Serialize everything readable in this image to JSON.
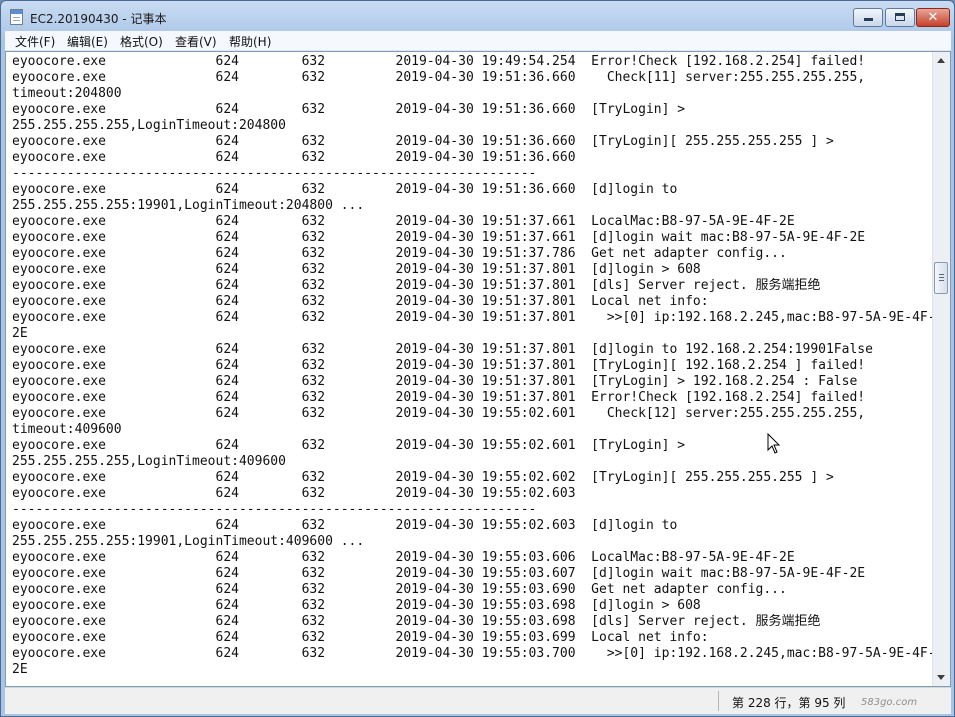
{
  "window": {
    "title": "EC2.20190430 - 记事本",
    "minimize_glyph": "",
    "close_glyph": "✕"
  },
  "menu": [
    {
      "label": "文件(F)"
    },
    {
      "label": "编辑(E)"
    },
    {
      "label": "格式(O)"
    },
    {
      "label": "查看(V)"
    },
    {
      "label": "帮助(H)"
    }
  ],
  "document": {
    "lines": [
      "eyoocore.exe              624        632         2019-04-30 19:49:54.254  Error!Check [192.168.2.254] failed!",
      "eyoocore.exe              624        632         2019-04-30 19:51:36.660    Check[11] server:255.255.255.255,",
      "timeout:204800",
      "eyoocore.exe              624        632         2019-04-30 19:51:36.660  [TryLogin] >",
      "255.255.255.255,LoginTimeout:204800",
      "eyoocore.exe              624        632         2019-04-30 19:51:36.660  [TryLogin][ 255.255.255.255 ] >",
      "eyoocore.exe              624        632         2019-04-30 19:51:36.660",
      "-------------------------------------------------------------------",
      "eyoocore.exe              624        632         2019-04-30 19:51:36.660  [d]login to",
      "255.255.255.255:19901,LoginTimeout:204800 ...",
      "eyoocore.exe              624        632         2019-04-30 19:51:37.661  LocalMac:B8-97-5A-9E-4F-2E",
      "eyoocore.exe              624        632         2019-04-30 19:51:37.661  [d]login wait mac:B8-97-5A-9E-4F-2E",
      "eyoocore.exe              624        632         2019-04-30 19:51:37.786  Get net adapter config...",
      "eyoocore.exe              624        632         2019-04-30 19:51:37.801  [d]login > 608",
      "eyoocore.exe              624        632         2019-04-30 19:51:37.801  [dls] Server reject. 服务端拒绝",
      "eyoocore.exe              624        632         2019-04-30 19:51:37.801  Local net info:",
      "eyoocore.exe              624        632         2019-04-30 19:51:37.801    >>[0] ip:192.168.2.245,mac:B8-97-5A-9E-4F-",
      "2E",
      "eyoocore.exe              624        632         2019-04-30 19:51:37.801  [d]login to 192.168.2.254:19901False",
      "eyoocore.exe              624        632         2019-04-30 19:51:37.801  [TryLogin][ 192.168.2.254 ] failed!",
      "eyoocore.exe              624        632         2019-04-30 19:51:37.801  [TryLogin] > 192.168.2.254 : False",
      "eyoocore.exe              624        632         2019-04-30 19:51:37.801  Error!Check [192.168.2.254] failed!",
      "eyoocore.exe              624        632         2019-04-30 19:55:02.601    Check[12] server:255.255.255.255,",
      "timeout:409600",
      "eyoocore.exe              624        632         2019-04-30 19:55:02.601  [TryLogin] >",
      "255.255.255.255,LoginTimeout:409600",
      "eyoocore.exe              624        632         2019-04-30 19:55:02.602  [TryLogin][ 255.255.255.255 ] >",
      "eyoocore.exe              624        632         2019-04-30 19:55:02.603",
      "-------------------------------------------------------------------",
      "eyoocore.exe              624        632         2019-04-30 19:55:02.603  [d]login to",
      "255.255.255.255:19901,LoginTimeout:409600 ...",
      "eyoocore.exe              624        632         2019-04-30 19:55:03.606  LocalMac:B8-97-5A-9E-4F-2E",
      "eyoocore.exe              624        632         2019-04-30 19:55:03.607  [d]login wait mac:B8-97-5A-9E-4F-2E",
      "eyoocore.exe              624        632         2019-04-30 19:55:03.690  Get net adapter config...",
      "eyoocore.exe              624        632         2019-04-30 19:55:03.698  [d]login > 608",
      "eyoocore.exe              624        632         2019-04-30 19:55:03.698  [dls] Server reject. 服务端拒绝",
      "eyoocore.exe              624        632         2019-04-30 19:55:03.699  Local net info:",
      "eyoocore.exe              624        632         2019-04-30 19:55:03.700    >>[0] ip:192.168.2.245,mac:B8-97-5A-9E-4F-",
      "2E"
    ]
  },
  "scrollbar": {
    "position_fraction": 0.34
  },
  "statusbar": {
    "position": "第 228 行，第 95 列",
    "watermark": "583go.com"
  }
}
